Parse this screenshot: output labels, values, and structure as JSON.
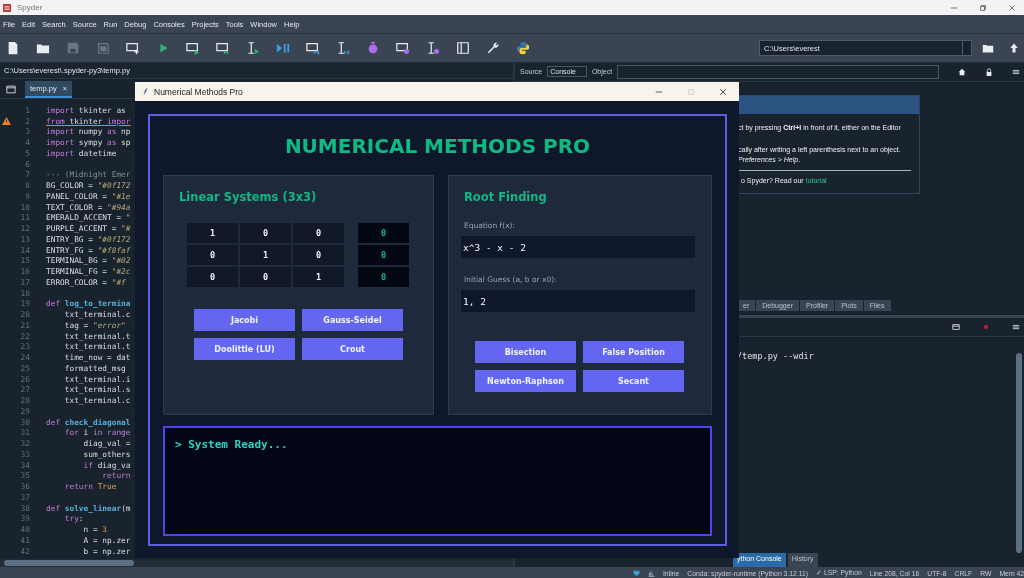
{
  "app_window": {
    "title": "Spyder"
  },
  "menu": [
    "File",
    "Edit",
    "Search",
    "Source",
    "Run",
    "Debug",
    "Consoles",
    "Projects",
    "Tools",
    "Window",
    "Help"
  ],
  "toolbar": {
    "working_directory": "C:\\Users\\everest"
  },
  "editor": {
    "path": "C:\\Users\\everest\\.spyder-py3\\temp.py",
    "tabs": [
      {
        "label": "temp.py",
        "close": "×",
        "selected": true
      }
    ],
    "lines": [
      {
        "number": "1",
        "warning": false,
        "segments": [
          {
            "kind": "keyword",
            "text": "import"
          },
          {
            "kind": "plain",
            "text": " tkinter as"
          }
        ]
      },
      {
        "number": "2",
        "warning": true,
        "segments": [
          {
            "kind": "keyword",
            "text": "from"
          },
          {
            "kind": "plain",
            "text": " tkinter "
          },
          {
            "kind": "keyword",
            "text": "impor"
          }
        ]
      },
      {
        "number": "3",
        "warning": false,
        "segments": [
          {
            "kind": "keyword",
            "text": "import"
          },
          {
            "kind": "plain",
            "text": " numpy "
          },
          {
            "kind": "keyword",
            "text": "as"
          },
          {
            "kind": "plain",
            "text": " np"
          }
        ]
      },
      {
        "number": "4",
        "warning": false,
        "segments": [
          {
            "kind": "keyword",
            "text": "import"
          },
          {
            "kind": "plain",
            "text": " sympy "
          },
          {
            "kind": "keyword",
            "text": "as"
          },
          {
            "kind": "plain",
            "text": " sp"
          }
        ]
      },
      {
        "number": "5",
        "warning": false,
        "segments": [
          {
            "kind": "keyword",
            "text": "import"
          },
          {
            "kind": "plain",
            "text": " datetime"
          }
        ]
      },
      {
        "number": "6",
        "warning": false
      },
      {
        "number": "7",
        "warning": false,
        "segments": [
          {
            "kind": "comment",
            "text": "--- (Midnight Emer"
          }
        ]
      },
      {
        "number": "8",
        "warning": false,
        "segments": [
          {
            "kind": "plain",
            "text": "BG_COLOR = "
          },
          {
            "kind": "string",
            "text": "\"#0f172"
          }
        ]
      },
      {
        "number": "9",
        "warning": false,
        "segments": [
          {
            "kind": "plain",
            "text": "PANEL_COLOR = "
          },
          {
            "kind": "string",
            "text": "\"#1e"
          }
        ]
      },
      {
        "number": "10",
        "warning": false,
        "segments": [
          {
            "kind": "plain",
            "text": "TEXT_COLOR = "
          },
          {
            "kind": "string",
            "text": "\"#94a"
          }
        ]
      },
      {
        "number": "11",
        "warning": false,
        "segments": [
          {
            "kind": "plain",
            "text": "EMERALD_ACCENT = "
          },
          {
            "kind": "string",
            "text": "\""
          }
        ]
      },
      {
        "number": "12",
        "warning": false,
        "segments": [
          {
            "kind": "plain",
            "text": "PURPLE_ACCENT = "
          },
          {
            "kind": "string",
            "text": "\"#"
          }
        ]
      },
      {
        "number": "13",
        "warning": false,
        "segments": [
          {
            "kind": "plain",
            "text": "ENTRY_BG = "
          },
          {
            "kind": "string",
            "text": "\"#0f172"
          }
        ]
      },
      {
        "number": "14",
        "warning": false,
        "segments": [
          {
            "kind": "plain",
            "text": "ENTRY_FG = "
          },
          {
            "kind": "string",
            "text": "\"#f8faf"
          }
        ]
      },
      {
        "number": "15",
        "warning": false,
        "segments": [
          {
            "kind": "plain",
            "text": "TERMINAL_BG = "
          },
          {
            "kind": "string",
            "text": "\"#02"
          }
        ]
      },
      {
        "number": "16",
        "warning": false,
        "segments": [
          {
            "kind": "plain",
            "text": "TERMINAL_FG = "
          },
          {
            "kind": "string",
            "text": "\"#2c"
          }
        ]
      },
      {
        "number": "17",
        "warning": false,
        "segments": [
          {
            "kind": "plain",
            "text": "ERROR_COLOR = "
          },
          {
            "kind": "string",
            "text": "\"#f"
          }
        ]
      },
      {
        "number": "18",
        "warning": false
      },
      {
        "number": "19",
        "warning": false,
        "segments": [
          {
            "kind": "keyword",
            "text": "def "
          },
          {
            "kind": "function",
            "text": "log_to_termina"
          }
        ]
      },
      {
        "number": "20",
        "warning": false,
        "segments": [
          {
            "kind": "plain",
            "text": "    txt_terminal.c"
          }
        ]
      },
      {
        "number": "21",
        "warning": false,
        "segments": [
          {
            "kind": "plain",
            "text": "    tag = "
          },
          {
            "kind": "string",
            "text": "\"error\""
          }
        ]
      },
      {
        "number": "22",
        "warning": false,
        "segments": [
          {
            "kind": "plain",
            "text": "    txt_terminal.t"
          }
        ]
      },
      {
        "number": "23",
        "warning": false,
        "segments": [
          {
            "kind": "plain",
            "text": "    txt_terminal.t"
          }
        ]
      },
      {
        "number": "24",
        "warning": false,
        "segments": [
          {
            "kind": "plain",
            "text": "    time_now = dat"
          }
        ]
      },
      {
        "number": "25",
        "warning": false,
        "segments": [
          {
            "kind": "plain",
            "text": "    formatted_msg"
          }
        ]
      },
      {
        "number": "26",
        "warning": false,
        "segments": [
          {
            "kind": "plain",
            "text": "    txt_terminal.i"
          }
        ]
      },
      {
        "number": "27",
        "warning": false,
        "segments": [
          {
            "kind": "plain",
            "text": "    txt_terminal.s"
          }
        ]
      },
      {
        "number": "28",
        "warning": false,
        "segments": [
          {
            "kind": "plain",
            "text": "    txt_terminal.c"
          }
        ]
      },
      {
        "number": "29",
        "warning": false
      },
      {
        "number": "30",
        "warning": false,
        "segments": [
          {
            "kind": "keyword",
            "text": "def "
          },
          {
            "kind": "function",
            "text": "check_diagonal"
          }
        ]
      },
      {
        "number": "31",
        "warning": false,
        "segments": [
          {
            "kind": "keyword",
            "text": "    for"
          },
          {
            "kind": "plain",
            "text": " i "
          },
          {
            "kind": "keyword",
            "text": "in"
          },
          {
            "kind": "builtin",
            "text": " range"
          }
        ]
      },
      {
        "number": "32",
        "warning": false,
        "segments": [
          {
            "kind": "plain",
            "text": "        diag_val ="
          }
        ]
      },
      {
        "number": "33",
        "warning": false,
        "segments": [
          {
            "kind": "plain",
            "text": "        sum_others"
          }
        ]
      },
      {
        "number": "34",
        "warning": false,
        "segments": [
          {
            "kind": "keyword",
            "text": "        if"
          },
          {
            "kind": "plain",
            "text": " diag_va"
          }
        ]
      },
      {
        "number": "35",
        "warning": false,
        "segments": [
          {
            "kind": "keyword",
            "text": "            return"
          }
        ]
      },
      {
        "number": "36",
        "warning": false,
        "segments": [
          {
            "kind": "keyword",
            "text": "    return"
          },
          {
            "kind": "constant",
            "text": " True"
          }
        ]
      },
      {
        "number": "37",
        "warning": false
      },
      {
        "number": "38",
        "warning": false,
        "segments": [
          {
            "kind": "keyword",
            "text": "def "
          },
          {
            "kind": "function",
            "text": "solve_linear"
          },
          {
            "kind": "plain",
            "text": "(m"
          }
        ]
      },
      {
        "number": "39",
        "warning": false,
        "segments": [
          {
            "kind": "keyword",
            "text": "    try"
          },
          {
            "kind": "plain",
            "text": ":"
          }
        ]
      },
      {
        "number": "40",
        "warning": false,
        "segments": [
          {
            "kind": "plain",
            "text": "        n = "
          },
          {
            "kind": "constant",
            "text": "3"
          }
        ]
      },
      {
        "number": "41",
        "warning": false,
        "segments": [
          {
            "kind": "plain",
            "text": "        A = np.zer"
          }
        ]
      },
      {
        "number": "42",
        "warning": false,
        "segments": [
          {
            "kind": "plain",
            "text": "        b = np.zer"
          }
        ]
      }
    ]
  },
  "help_pane": {
    "source_label": "Source",
    "source_value": "Console",
    "object_label": "Object",
    "card_lines": [
      "ct by pressing **Ctrl+I** in front of it, either on the Editor",
      "cally after writing a left parenthesis next to an object.",
      "*Preferences > Help*."
    ],
    "card_question": "o Spyder? Read our",
    "card_link": "tutorial"
  },
  "pane_tabs": [
    {
      "label": "er",
      "selected": false
    },
    {
      "label": "Debugger",
      "selected": false
    },
    {
      "label": "Profiler",
      "selected": false
    },
    {
      "label": "Plots",
      "selected": false
    },
    {
      "label": "Files",
      "selected": false
    }
  ],
  "console": {
    "text": "/temp.py --wdir"
  },
  "console_tabs": [
    {
      "label": "ython Console",
      "selected": true
    },
    {
      "label": "History",
      "selected": false
    }
  ],
  "status_bar": {
    "plot_mode": "Inline",
    "items": [
      "Conda: spyder-runtime (Python 3.12.11)",
      "✓ LSP: Python",
      "Line 208, Col 16",
      "UTF-8",
      "CRLF",
      "RW",
      "Mem 42"
    ]
  },
  "dialog": {
    "title": "Numerical Methods Pro",
    "heading": "NUMERICAL METHODS PRO",
    "linear": {
      "title": "Linear Systems (3x3)",
      "matrix": [
        [
          "1",
          "0",
          "0"
        ],
        [
          "0",
          "1",
          "0"
        ],
        [
          "0",
          "0",
          "1"
        ]
      ],
      "rhs": [
        "0",
        "0",
        "0"
      ],
      "buttons": [
        "Jacobi",
        "Gauss-Seidel",
        "Doolittle (LU)",
        "Crout"
      ]
    },
    "roots": {
      "title": "Root Finding",
      "equation_label": "Equation f(x):",
      "equation": "x^3 - x - 2",
      "guess_label": "Initial Guess (a, b or x0):",
      "guess": "1, 2",
      "buttons": [
        "Bisection",
        "False Position",
        "Newton-Raphson",
        "Secant"
      ]
    },
    "terminal": "> System Ready..."
  }
}
